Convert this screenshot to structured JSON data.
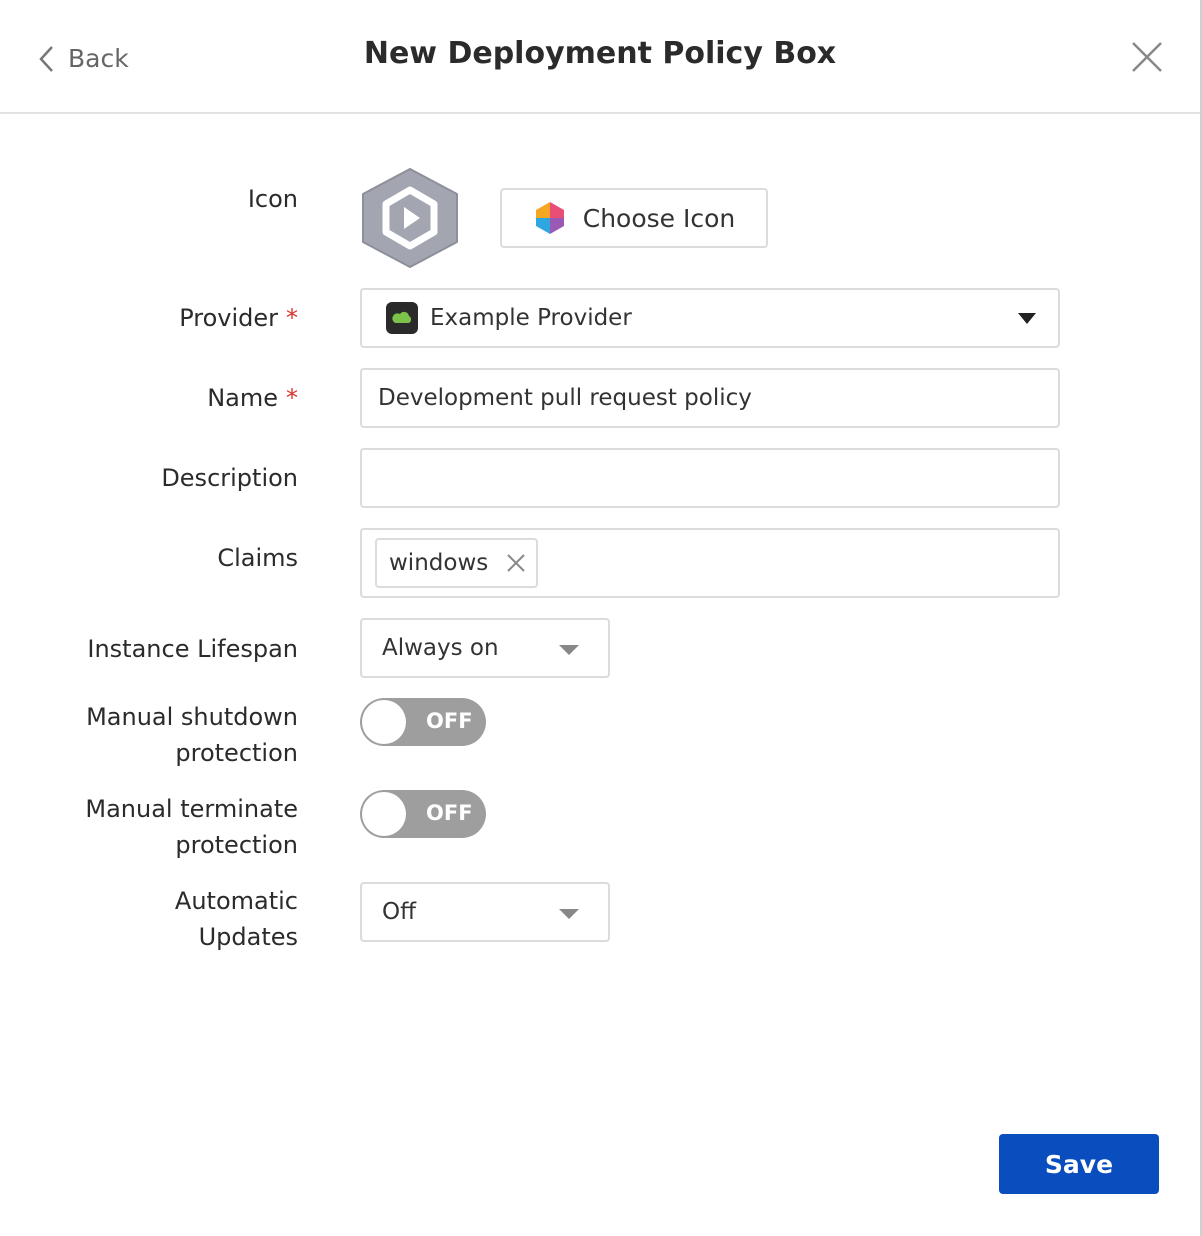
{
  "header": {
    "back_label": "Back",
    "title": "New Deployment Policy Box"
  },
  "form": {
    "icon": {
      "label": "Icon",
      "choose_label": "Choose Icon"
    },
    "provider": {
      "label": "Provider",
      "required": "*",
      "value": "Example Provider"
    },
    "name": {
      "label": "Name",
      "required": "*",
      "value": "Development pull request policy"
    },
    "description": {
      "label": "Description",
      "value": ""
    },
    "claims": {
      "label": "Claims",
      "tags": [
        "windows"
      ]
    },
    "lifespan": {
      "label": "Instance Lifespan",
      "value": "Always on"
    },
    "shutdown": {
      "label_line1": "Manual shutdown",
      "label_line2": "protection",
      "state": "OFF"
    },
    "terminate": {
      "label_line1": "Manual terminate",
      "label_line2": "protection",
      "state": "OFF"
    },
    "updates": {
      "label_line1": "Automatic",
      "label_line2": "Updates",
      "value": "Off"
    }
  },
  "save_label": "Save",
  "colors": {
    "primary": "#0a4dbf",
    "required": "#d9342b",
    "toggle_off": "#9e9e9e"
  }
}
